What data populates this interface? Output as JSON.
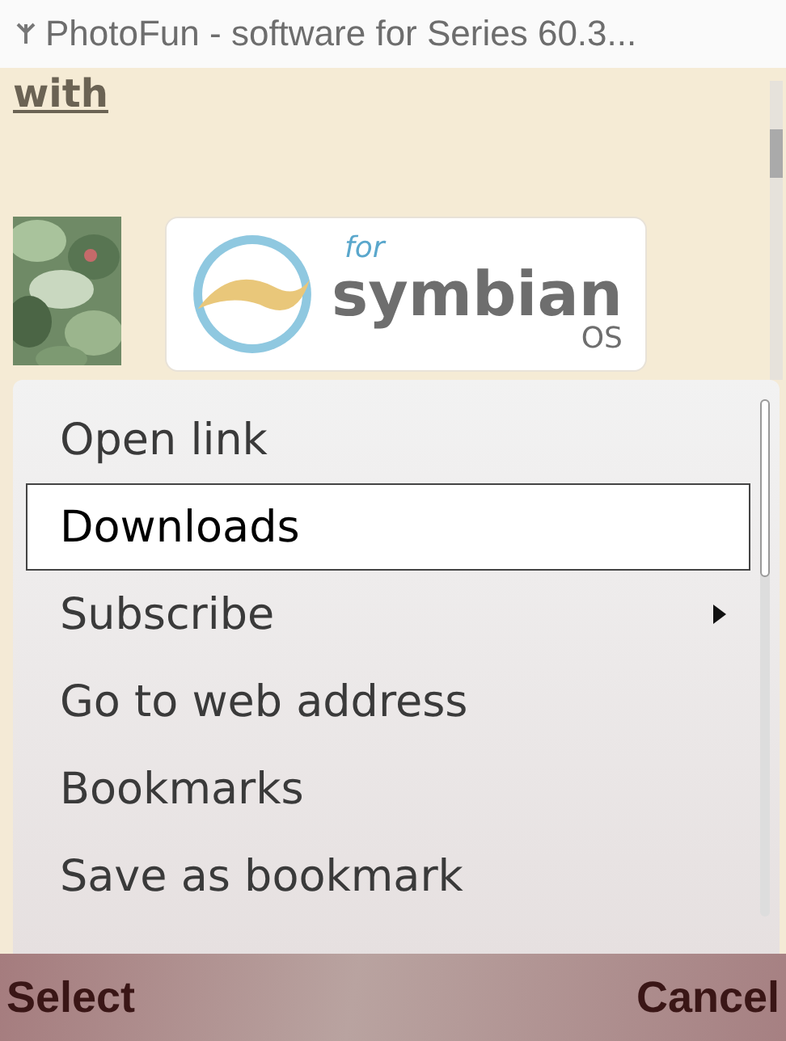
{
  "title_bar": {
    "title": "PhotoFun - software for Series 60.3..."
  },
  "page": {
    "link": "with",
    "logo": {
      "small": "for",
      "name": "symbian",
      "suffix": "OS"
    }
  },
  "menu": {
    "items": [
      {
        "label": "Open link",
        "selected": false,
        "submenu": false
      },
      {
        "label": "Downloads",
        "selected": true,
        "submenu": false
      },
      {
        "label": "Subscribe",
        "selected": false,
        "submenu": true
      },
      {
        "label": "Go to web address",
        "selected": false,
        "submenu": false
      },
      {
        "label": "Bookmarks",
        "selected": false,
        "submenu": false
      },
      {
        "label": "Save as bookmark",
        "selected": false,
        "submenu": false
      }
    ]
  },
  "softkeys": {
    "left": "Select",
    "right": "Cancel"
  }
}
